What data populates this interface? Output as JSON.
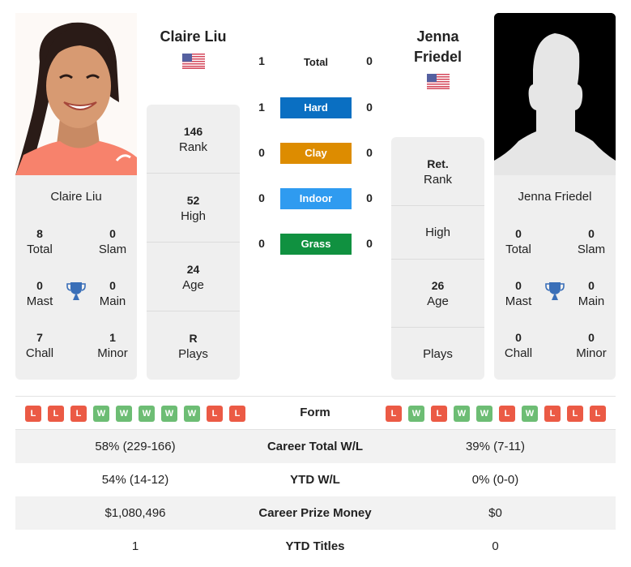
{
  "player1": {
    "name": "Claire Liu",
    "country_flag": "us-flag",
    "rank": {
      "value": "146",
      "label": "Rank"
    },
    "high": {
      "value": "52",
      "label": "High"
    },
    "age": {
      "value": "24",
      "label": "Age"
    },
    "plays": {
      "value": "R",
      "label": "Plays"
    },
    "titles": {
      "total": {
        "value": "8",
        "label": "Total"
      },
      "slam": {
        "value": "0",
        "label": "Slam"
      },
      "mast": {
        "value": "0",
        "label": "Mast"
      },
      "main": {
        "value": "0",
        "label": "Main"
      },
      "chall": {
        "value": "7",
        "label": "Chall"
      },
      "minor": {
        "value": "1",
        "label": "Minor"
      }
    },
    "form": [
      "L",
      "L",
      "L",
      "W",
      "W",
      "W",
      "W",
      "W",
      "L",
      "L"
    ]
  },
  "player2": {
    "name_line1": "Jenna",
    "name_line2": "Friedel",
    "name": "Jenna Friedel",
    "country_flag": "us-flag",
    "rank": {
      "value": "Ret.",
      "label": "Rank"
    },
    "high": {
      "value": "",
      "label": "High"
    },
    "age": {
      "value": "26",
      "label": "Age"
    },
    "plays": {
      "value": "",
      "label": "Plays"
    },
    "titles": {
      "total": {
        "value": "0",
        "label": "Total"
      },
      "slam": {
        "value": "0",
        "label": "Slam"
      },
      "mast": {
        "value": "0",
        "label": "Mast"
      },
      "main": {
        "value": "0",
        "label": "Main"
      },
      "chall": {
        "value": "0",
        "label": "Chall"
      },
      "minor": {
        "value": "0",
        "label": "Minor"
      }
    },
    "form": [
      "L",
      "W",
      "L",
      "W",
      "W",
      "L",
      "W",
      "L",
      "L",
      "L"
    ]
  },
  "h2h": {
    "total": {
      "label": "Total",
      "p1": "1",
      "p2": "0"
    },
    "surfaces": [
      {
        "label": "Hard",
        "p1": "1",
        "p2": "0",
        "color": "#0a6fc2"
      },
      {
        "label": "Clay",
        "p1": "0",
        "p2": "0",
        "color": "#dd8c00"
      },
      {
        "label": "Indoor",
        "p1": "0",
        "p2": "0",
        "color": "#2f9bf0"
      },
      {
        "label": "Grass",
        "p1": "0",
        "p2": "0",
        "color": "#109140"
      }
    ]
  },
  "form_label": "Form",
  "form_colors": {
    "W": "#6dbd74",
    "L": "#eb5a45"
  },
  "comparison": [
    {
      "label": "Career Total W/L",
      "p1": "58% (229-166)",
      "p2": "39% (7-11)"
    },
    {
      "label": "YTD W/L",
      "p1": "54% (14-12)",
      "p2": "0% (0-0)"
    },
    {
      "label": "Career Prize Money",
      "p1": "$1,080,496",
      "p2": "$0"
    },
    {
      "label": "YTD Titles",
      "p1": "1",
      "p2": "0"
    }
  ],
  "trophy_color": "#3a6fb8"
}
